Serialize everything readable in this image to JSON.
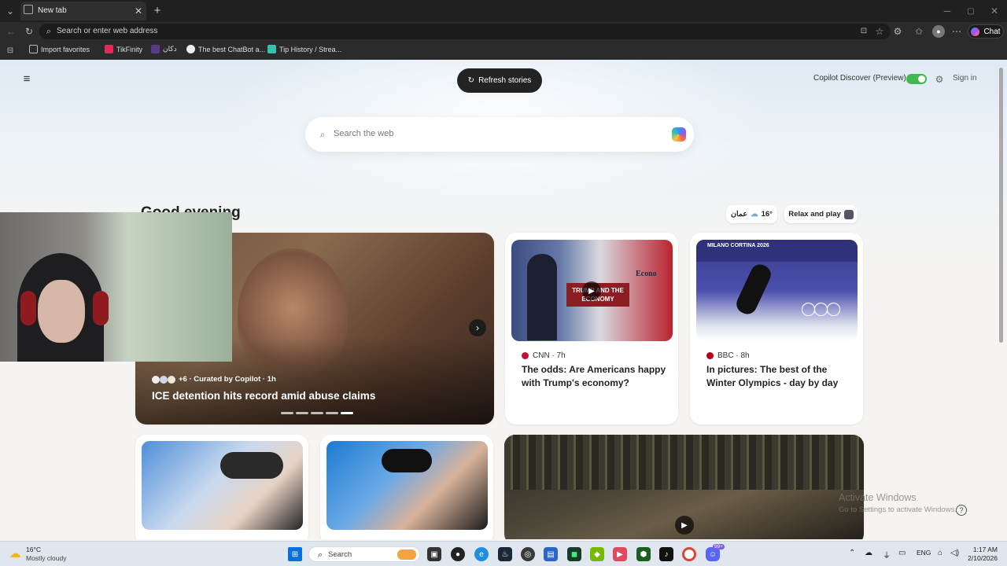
{
  "browser": {
    "tab_title": "New tab",
    "new_tab_symbol": "+",
    "address_placeholder": "Search or enter web address",
    "chat_label": "Chat",
    "favorites": [
      "Import favorites",
      "TikFinity",
      "دكان",
      "The best ChatBot a...",
      "Tip History / Strea..."
    ]
  },
  "newtab": {
    "refresh_label": "Refresh stories",
    "copilot_discover": "Copilot Discover (Preview)",
    "copilot_toggle_on": true,
    "sign_in": "Sign in",
    "search_placeholder": "Search the web",
    "greeting": "Good evening",
    "weather_city": "عمان",
    "weather_temp": "16°",
    "relax_label": "Relax and play"
  },
  "hero": {
    "meta": "+6 · Curated by Copilot · 1h",
    "headline": "ICE detention hits record amid abuse claims",
    "carousel_total": 5,
    "carousel_active": 4
  },
  "cards": [
    {
      "source": "CNN · 7h",
      "headline": "The odds: Are Americans happy with Trump's economy?",
      "thumb_caption": "TRUMP AND THE ECONOMY",
      "thumb_brand": "Econo"
    },
    {
      "source": "BBC · 8h",
      "headline": "In pictures: The best of the Winter Olympics - day by day",
      "thumb_caption": "MILANO CORTINA 2026"
    }
  ],
  "watermark": {
    "line1": "Activate Windows",
    "line2": "Go to Settings to activate Windows."
  },
  "taskbar": {
    "weather_temp": "16°C",
    "weather_desc": "Mostly cloudy",
    "search_label": "Search",
    "lang": "ENG",
    "time": "1:17 AM",
    "date": "2/10/2026",
    "badge_count": "99+"
  },
  "colors": {
    "toggle": "#3fb950",
    "accent_red": "#c4122f"
  }
}
